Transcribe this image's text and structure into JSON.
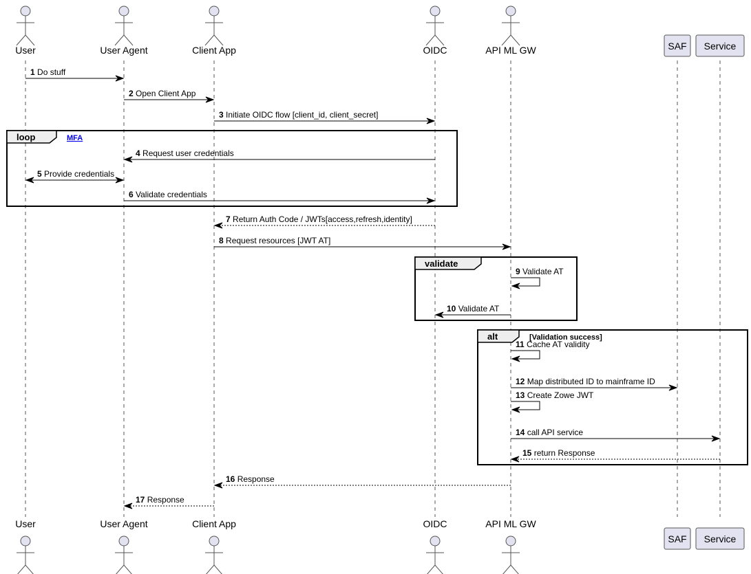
{
  "diagram": {
    "type": "sequence",
    "participants": [
      {
        "id": "user",
        "label": "User",
        "kind": "actor"
      },
      {
        "id": "user_agent",
        "label": "User Agent",
        "kind": "actor"
      },
      {
        "id": "client_app",
        "label": "Client App",
        "kind": "actor"
      },
      {
        "id": "oidc",
        "label": "OIDC",
        "kind": "actor"
      },
      {
        "id": "gw",
        "label": "API ML GW",
        "kind": "actor"
      },
      {
        "id": "saf",
        "label": "SAF",
        "kind": "participant"
      },
      {
        "id": "service",
        "label": "Service",
        "kind": "participant"
      }
    ],
    "messages": [
      {
        "num": "1",
        "text": "Do stuff",
        "from": "user",
        "to": "user_agent",
        "style": "solid"
      },
      {
        "num": "2",
        "text": "Open Client App",
        "from": "user_agent",
        "to": "client_app",
        "style": "solid"
      },
      {
        "num": "3",
        "text": "Initiate OIDC flow [client_id, client_secret]",
        "from": "client_app",
        "to": "oidc",
        "style": "solid"
      },
      {
        "num": "4",
        "text": "Request user credentials",
        "from": "oidc",
        "to": "user_agent",
        "style": "solid"
      },
      {
        "num": "5",
        "text": "Provide credentials",
        "from": "user",
        "to": "user_agent",
        "style": "bidirectional"
      },
      {
        "num": "6",
        "text": "Validate credentials",
        "from": "user_agent",
        "to": "oidc",
        "style": "solid"
      },
      {
        "num": "7",
        "text": "Return Auth Code / JWTs[access,refresh,identity]",
        "from": "oidc",
        "to": "client_app",
        "style": "dashed"
      },
      {
        "num": "8",
        "text": "Request resources [JWT AT]",
        "from": "client_app",
        "to": "gw",
        "style": "solid"
      },
      {
        "num": "9",
        "text": "Validate AT",
        "from": "gw",
        "to": "gw",
        "style": "self"
      },
      {
        "num": "10",
        "text": "Validate AT",
        "from": "gw",
        "to": "oidc",
        "style": "solid"
      },
      {
        "num": "11",
        "text": "Cache AT validity",
        "from": "gw",
        "to": "gw",
        "style": "self"
      },
      {
        "num": "12",
        "text": "Map distributed ID to mainframe ID",
        "from": "gw",
        "to": "saf",
        "style": "solid"
      },
      {
        "num": "13",
        "text": "Create Zowe JWT",
        "from": "gw",
        "to": "gw",
        "style": "self"
      },
      {
        "num": "14",
        "text": "call API service",
        "from": "gw",
        "to": "service",
        "style": "solid"
      },
      {
        "num": "15",
        "text": "return Response",
        "from": "service",
        "to": "gw",
        "style": "dashed"
      },
      {
        "num": "16",
        "text": "Response",
        "from": "gw",
        "to": "client_app",
        "style": "dashed"
      },
      {
        "num": "17",
        "text": "Response",
        "from": "client_app",
        "to": "user_agent",
        "style": "dashed"
      }
    ],
    "fragments": [
      {
        "kind": "loop",
        "label": "loop",
        "guard": "MFA",
        "guard_is_link": true,
        "covers_messages": [
          "4",
          "5",
          "6"
        ]
      },
      {
        "kind": "group",
        "label": "validate",
        "guard": "",
        "guard_is_link": false,
        "covers_messages": [
          "9",
          "10"
        ]
      },
      {
        "kind": "alt",
        "label": "alt",
        "guard": "[Validation success]",
        "guard_is_link": false,
        "covers_messages": [
          "11",
          "12",
          "13",
          "14",
          "15"
        ]
      }
    ]
  }
}
